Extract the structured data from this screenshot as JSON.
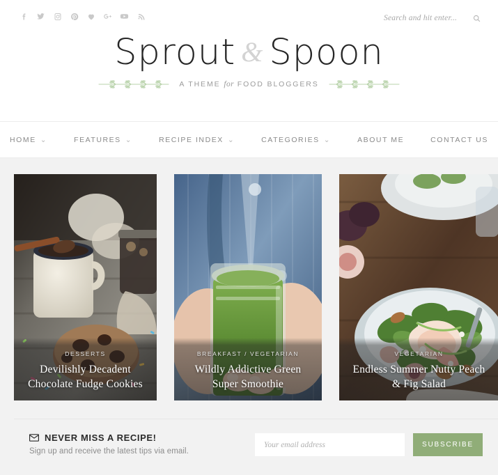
{
  "site": {
    "logo_main_1": "Sprout",
    "logo_amp": "&",
    "logo_main_2": "Spoon",
    "tagline_pre": "A Theme ",
    "tagline_em": "for",
    "tagline_post": " Food Bloggers"
  },
  "topbar": {
    "social": [
      {
        "name": "facebook-icon",
        "label": "Facebook"
      },
      {
        "name": "twitter-icon",
        "label": "Twitter"
      },
      {
        "name": "instagram-icon",
        "label": "Instagram"
      },
      {
        "name": "pinterest-icon",
        "label": "Pinterest"
      },
      {
        "name": "bloglovin-icon",
        "label": "Bloglovin"
      },
      {
        "name": "googleplus-icon",
        "label": "Google Plus"
      },
      {
        "name": "youtube-icon",
        "label": "YouTube"
      },
      {
        "name": "rss-icon",
        "label": "RSS"
      }
    ],
    "search_placeholder": "Search and hit enter...",
    "search_value": ""
  },
  "nav": {
    "items": [
      {
        "label": "Home",
        "has_dropdown": true
      },
      {
        "label": "Features",
        "has_dropdown": true
      },
      {
        "label": "Recipe Index",
        "has_dropdown": true
      },
      {
        "label": "Categories",
        "has_dropdown": true
      },
      {
        "label": "About Me",
        "has_dropdown": false
      },
      {
        "label": "Contact Us",
        "has_dropdown": false
      }
    ],
    "caret_glyph": "⌄"
  },
  "cards": [
    {
      "categories": "Desserts",
      "title": "Devilishly Decadent Chocolate Fudge Cookies",
      "image_alt": "chocolate cookie and enamel mug of cocoa on weathered wood with sprinkles"
    },
    {
      "categories": "Breakfast / Vegetarian",
      "title": "Wildly Addictive Green Super Smoothie",
      "image_alt": "hands in denim shirt holding a mason jar of green smoothie"
    },
    {
      "categories": "Vegetarian",
      "title": "Endless Summer Nutty Peach & Fig Salad",
      "image_alt": "peach and fig salad with arugula on a white plate on dark wood"
    }
  ],
  "newsletter": {
    "heading": "Never Miss a Recipe!",
    "subtext": "Sign up and receive the latest tips via email.",
    "email_placeholder": "Your email address",
    "email_value": "",
    "button_label": "Subscribe"
  },
  "colors": {
    "accent_green": "#90ad78",
    "page_bg": "#f2f2f2",
    "content_bg": "#ffffff",
    "nav_text": "#8a8a8a",
    "logo_text": "#262626"
  }
}
